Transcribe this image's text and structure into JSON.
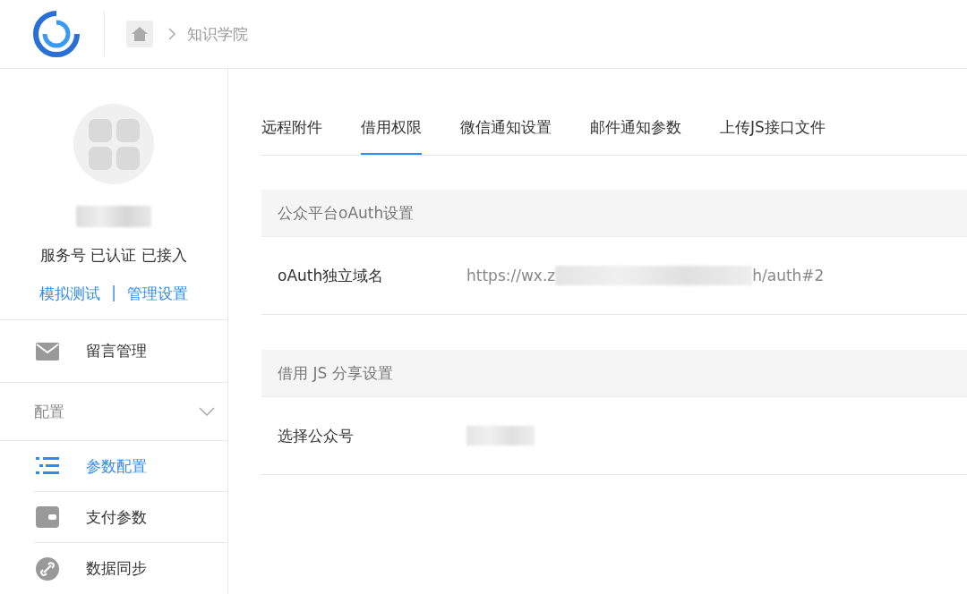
{
  "header": {
    "breadcrumb": [
      {
        "label": "知识学院"
      }
    ]
  },
  "account": {
    "status": "服务号 已认证 已接入",
    "links": [
      "模拟测试",
      "管理设置"
    ],
    "separator": "|"
  },
  "menu": [
    {
      "kind": "item",
      "label": "留言管理",
      "selected": false
    },
    {
      "kind": "group",
      "label": "配置",
      "expanded": true,
      "children": [
        {
          "label": "参数配置",
          "selected": true
        },
        {
          "label": "支付参数",
          "selected": false
        },
        {
          "label": "数据同步",
          "selected": false
        }
      ]
    }
  ],
  "tabs": [
    {
      "label": "远程附件",
      "selected": false
    },
    {
      "label": "借用权限",
      "selected": true
    },
    {
      "label": "微信通知设置",
      "selected": false
    },
    {
      "label": "邮件通知参数",
      "selected": false
    },
    {
      "label": "上传JS接口文件",
      "selected": false
    }
  ],
  "sections": [
    {
      "title": "公众平台oAuth设置",
      "rows": [
        {
          "label": "oAuth独立域名",
          "value_start": "https://wx.z",
          "value_end": "h/auth#2"
        }
      ]
    },
    {
      "title": "借用 JS 分享设置",
      "rows": [
        {
          "label": "选择公众号"
        }
      ]
    }
  ]
}
